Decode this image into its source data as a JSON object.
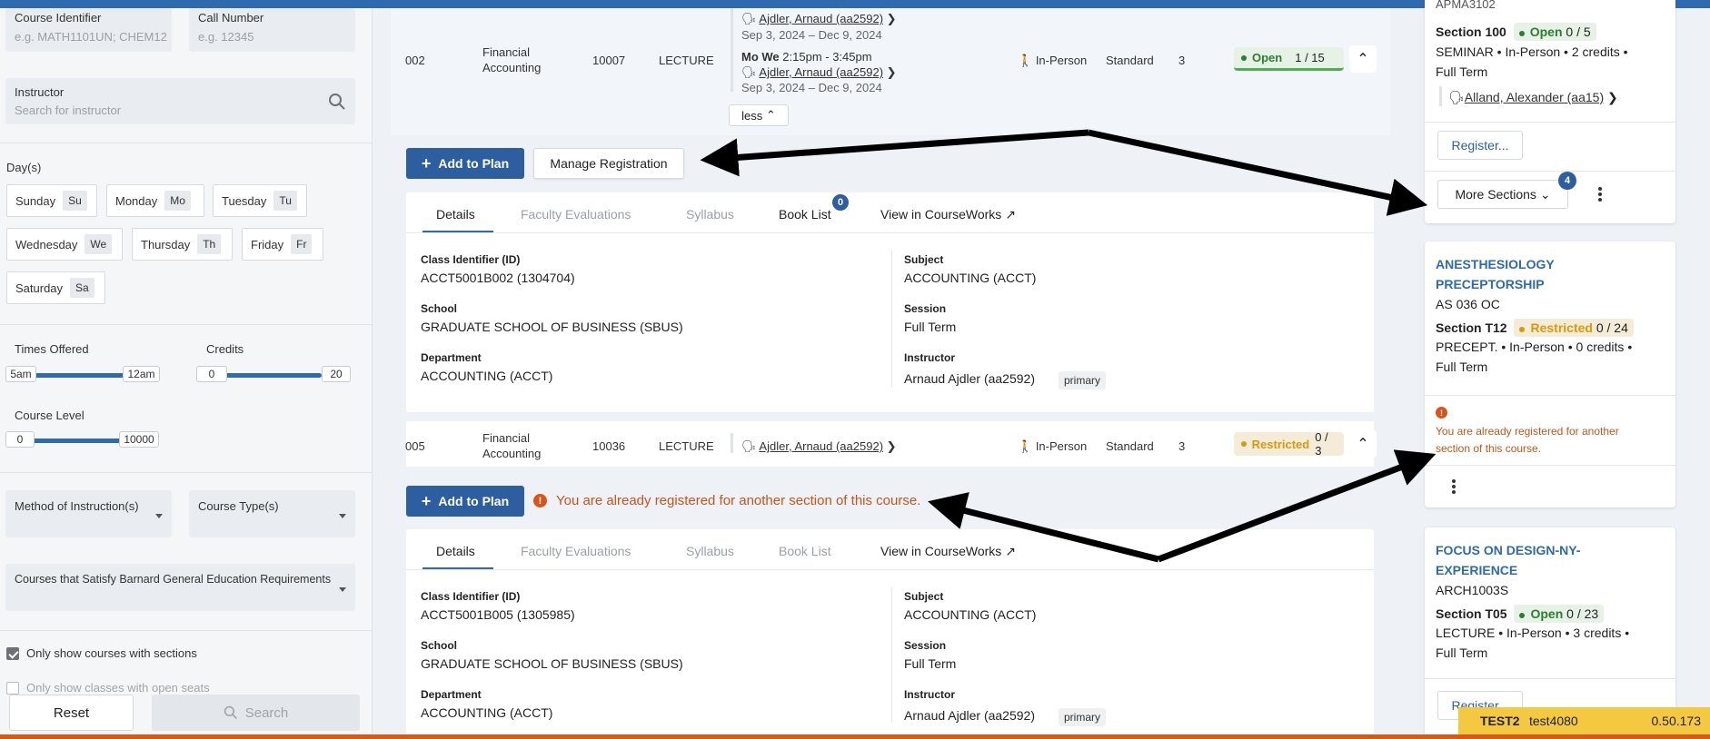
{
  "filters": {
    "course_identifier": {
      "label": "Course Identifier",
      "placeholder": "e.g. MATH1101UN; CHEM12"
    },
    "call_number": {
      "label": "Call Number",
      "placeholder": "e.g. 12345"
    },
    "instructor": {
      "label": "Instructor",
      "placeholder": "Search for instructor"
    },
    "days_label": "Day(s)",
    "days": [
      {
        "label": "Sunday",
        "abbr": "Su"
      },
      {
        "label": "Monday",
        "abbr": "Mo"
      },
      {
        "label": "Tuesday",
        "abbr": "Tu"
      },
      {
        "label": "Wednesday",
        "abbr": "We"
      },
      {
        "label": "Thursday",
        "abbr": "Th"
      },
      {
        "label": "Friday",
        "abbr": "Fr"
      },
      {
        "label": "Saturday",
        "abbr": "Sa"
      }
    ],
    "times_offered": {
      "label": "Times Offered",
      "min": "5am",
      "max": "12am"
    },
    "credits": {
      "label": "Credits",
      "min": "0",
      "max": "20"
    },
    "course_level": {
      "label": "Course Level",
      "min": "0",
      "max": "10000"
    },
    "method": "Method of Instruction(s)",
    "course_type": "Course Type(s)",
    "barnard": "Courses that Satisfy Barnard General Education Requirements",
    "only_sections": "Only show courses with sections",
    "only_open": "Only show classes with open seats",
    "reset": "Reset",
    "search": "Search"
  },
  "sections": [
    {
      "number": "002",
      "title": "Financial Accounting",
      "call": "10007",
      "type": "LECTURE",
      "instructor_top": "Ajdler, Arnaud (aa2592)",
      "dates_top": "Sep 3, 2024 – Dec 9, 2024",
      "days": "Mo We",
      "time": "2:15pm - 3:45pm",
      "instructor": "Ajdler, Arnaud (aa2592)",
      "dates": "Sep 3, 2024 – Dec 9, 2024",
      "less": "less",
      "mode": "In-Person",
      "grading": "Standard",
      "credits": "3",
      "status": "Open",
      "seats": "1 / 15",
      "add_plan": "Add to Plan",
      "manage": "Manage Registration",
      "tabs": [
        "Details",
        "Faculty Evaluations",
        "Syllabus",
        "Book List",
        "View in CourseWorks"
      ],
      "book_count": "0",
      "details": {
        "class_id_label": "Class Identifier (ID)",
        "class_id": "ACCT5001B002 (1304704)",
        "school_label": "School",
        "school": "GRADUATE SCHOOL OF BUSINESS (SBUS)",
        "dept_label": "Department",
        "dept": "ACCOUNTING (ACCT)",
        "subject_label": "Subject",
        "subject": "ACCOUNTING (ACCT)",
        "session_label": "Session",
        "session": "Full Term",
        "instructor_label": "Instructor",
        "instructor": "Arnaud Ajdler (aa2592)",
        "role": "primary"
      }
    },
    {
      "number": "005",
      "title": "Financial Accounting",
      "call": "10036",
      "type": "LECTURE",
      "instructor": "Ajdler, Arnaud (aa2592)",
      "mode": "In-Person",
      "grading": "Standard",
      "credits": "3",
      "status": "Restricted",
      "seats": "0 / 3",
      "add_plan": "Add to Plan",
      "warning": "You are already registered for another section of this course.",
      "tabs": [
        "Details",
        "Faculty Evaluations",
        "Syllabus",
        "Book List",
        "View in CourseWorks"
      ],
      "details": {
        "class_id_label": "Class Identifier (ID)",
        "class_id": "ACCT5001B005 (1305985)",
        "school_label": "School",
        "school": "GRADUATE SCHOOL OF BUSINESS (SBUS)",
        "dept_label": "Department",
        "dept": "ACCOUNTING (ACCT)",
        "subject_label": "Subject",
        "subject": "ACCOUNTING (ACCT)",
        "session_label": "Session",
        "session": "Full Term",
        "instructor_label": "Instructor",
        "instructor": "Arnaud Ajdler (aa2592)",
        "role": "primary"
      }
    }
  ],
  "cards": [
    {
      "code": "APMA3102",
      "section": "Section 100",
      "status": "Open",
      "seats": "0 / 5",
      "meta": "SEMINAR • In-Person • 2 credits •",
      "term": "Full Term",
      "instructor": "Alland, Alexander (aa15)",
      "register": "Register...",
      "more_sections": "More Sections",
      "more_count": "4"
    },
    {
      "title": "ANESTHESIOLOGY PRECEPTORSHIP",
      "code": "AS 036 OC",
      "section": "Section T12",
      "status": "Restricted",
      "seats": "0 / 24",
      "meta": "PRECEPT. • In-Person • 0 credits •",
      "term": "Full Term",
      "warning": "You are already registered for another section of this course."
    },
    {
      "title": "FOCUS ON DESIGN-NY-EXPERIENCE",
      "code": "ARCH1003S",
      "section": "Section T05",
      "status": "Open",
      "seats": "0 / 23",
      "meta": "LECTURE • In-Person • 3 credits •",
      "term": "Full Term",
      "register": "Register..."
    }
  ],
  "env": {
    "name": "TEST2",
    "user": "test4080",
    "version": "0.50.173"
  },
  "colors": {
    "accent": "#2d6ab0",
    "open": "#2e7d32",
    "restricted": "#d89a0a",
    "warning": "#c4561a"
  }
}
